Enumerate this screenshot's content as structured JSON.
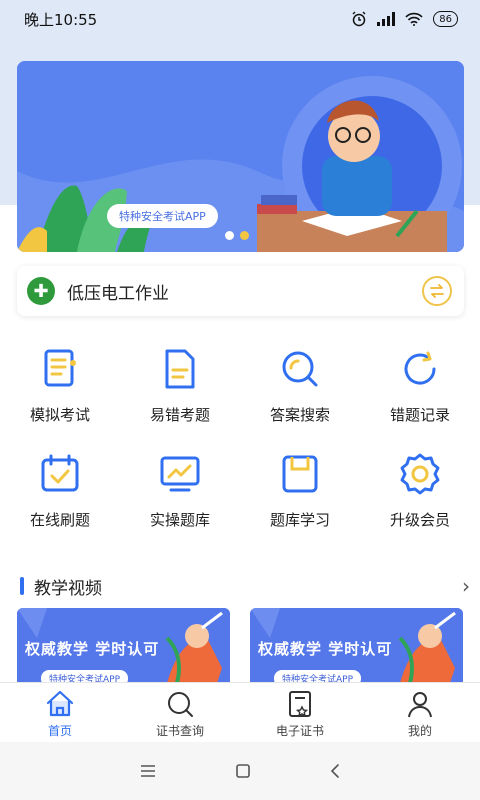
{
  "status_bar": {
    "time": "晚上10:55",
    "battery": "86"
  },
  "banner": {
    "pill_text": "特种安全考试APP"
  },
  "category": {
    "label": "低压电工作业"
  },
  "features": [
    {
      "label": "模拟考试",
      "icon": "exam-icon"
    },
    {
      "label": "易错考题",
      "icon": "document-icon"
    },
    {
      "label": "答案搜索",
      "icon": "search-icon"
    },
    {
      "label": "错题记录",
      "icon": "refresh-icon"
    },
    {
      "label": "在线刷题",
      "icon": "calendar-check-icon"
    },
    {
      "label": "实操题库",
      "icon": "monitor-chart-icon"
    },
    {
      "label": "题库学习",
      "icon": "box-icon"
    },
    {
      "label": "升级会员",
      "icon": "gear-icon"
    }
  ],
  "section": {
    "title": "教学视频",
    "more": "›"
  },
  "videos": [
    {
      "title": "权威教学 学时认可",
      "pill": "特种安全考试APP"
    },
    {
      "title": "权威教学 学时认可",
      "pill": "特种安全考试APP"
    }
  ],
  "tabs": [
    {
      "label": "首页",
      "icon": "home-icon"
    },
    {
      "label": "证书查询",
      "icon": "search-icon"
    },
    {
      "label": "电子证书",
      "icon": "certificate-icon"
    },
    {
      "label": "我的",
      "icon": "user-icon"
    }
  ],
  "colors": {
    "accent": "#2f6ff0",
    "highlight": "#f2c640",
    "banner": "#5b83f0"
  }
}
